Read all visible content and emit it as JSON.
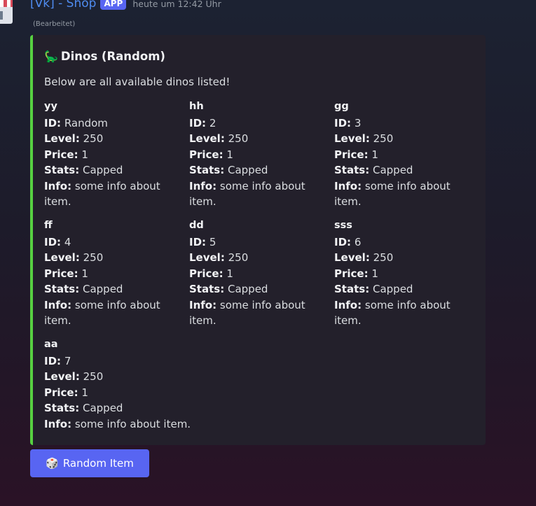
{
  "message": {
    "author": "[Vk] - Shop",
    "app_badge": "APP",
    "timestamp": "heute um 12:42 Uhr",
    "edited": "(Bearbeitet)"
  },
  "embed": {
    "accent_color": "#57d141",
    "title_emoji": "🦕",
    "title": "Dinos (Random)",
    "description": "Below are all available dinos listed!",
    "fields": [
      {
        "name": "yy",
        "id": "Random",
        "level": "250",
        "price": "1",
        "stats": "Capped",
        "info": "some info about item."
      },
      {
        "name": "hh",
        "id": "2",
        "level": "250",
        "price": "1",
        "stats": "Capped",
        "info": "some info about item."
      },
      {
        "name": "gg",
        "id": "3",
        "level": "250",
        "price": "1",
        "stats": "Capped",
        "info": "some info about item."
      },
      {
        "name": "ff",
        "id": "4",
        "level": "250",
        "price": "1",
        "stats": "Capped",
        "info": "some info about item."
      },
      {
        "name": "dd",
        "id": "5",
        "level": "250",
        "price": "1",
        "stats": "Capped",
        "info": "some info about item."
      },
      {
        "name": "sss",
        "id": "6",
        "level": "250",
        "price": "1",
        "stats": "Capped",
        "info": "some info about item."
      },
      {
        "name": "aa",
        "id": "7",
        "level": "250",
        "price": "1",
        "stats": "Capped",
        "info": "some info about item."
      }
    ],
    "labels": {
      "id": "ID:",
      "level": "Level:",
      "price": "Price:",
      "stats": "Stats:",
      "info": "Info:"
    }
  },
  "button": {
    "emoji": "🎲",
    "label": "Random Item",
    "color": "#5865f2"
  }
}
